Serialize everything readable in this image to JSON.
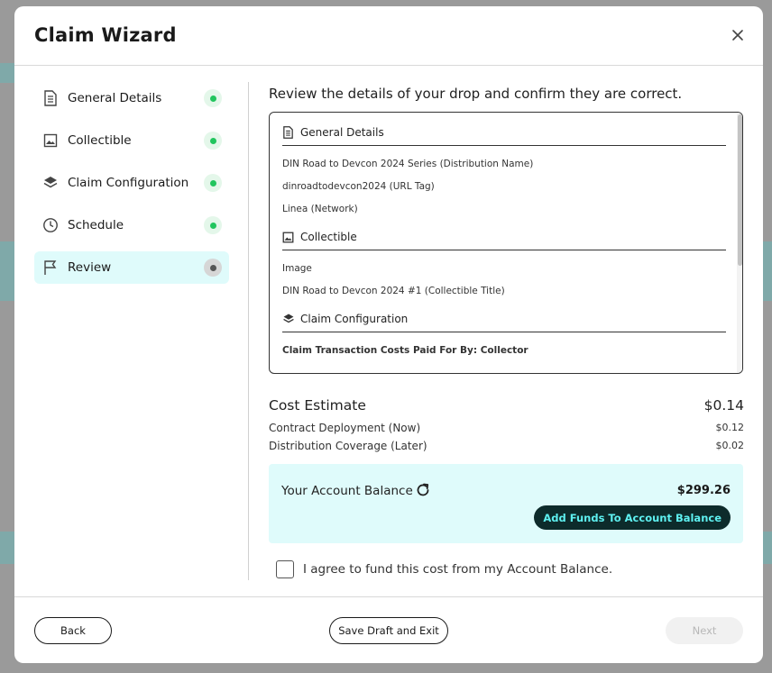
{
  "modal": {
    "title": "Claim Wizard"
  },
  "steps": [
    {
      "label": "General Details",
      "icon": "document-icon",
      "status": "complete"
    },
    {
      "label": "Collectible",
      "icon": "image-icon",
      "status": "complete"
    },
    {
      "label": "Claim Configuration",
      "icon": "layers-icon",
      "status": "complete"
    },
    {
      "label": "Schedule",
      "icon": "clock-icon",
      "status": "complete"
    },
    {
      "label": "Review",
      "icon": "flag-icon",
      "status": "current"
    }
  ],
  "review": {
    "intro": "Review the details of your drop and confirm they are correct.",
    "general": {
      "heading": "General Details",
      "items": [
        "DIN Road to Devcon 2024 Series (Distribution Name)",
        "dinroadtodevcon2024 (URL Tag)",
        "Linea (Network)"
      ]
    },
    "collectible": {
      "heading": "Collectible",
      "items": [
        "Image",
        "DIN Road to Devcon 2024 #1 (Collectible Title)"
      ]
    },
    "claim": {
      "heading": "Claim Configuration",
      "items": [
        "Claim Transaction Costs Paid For By: Collector"
      ]
    }
  },
  "cost": {
    "title": "Cost Estimate",
    "total": "$0.14",
    "rows": [
      {
        "label": "Contract Deployment (Now)",
        "value": "$0.12"
      },
      {
        "label": "Distribution Coverage (Later)",
        "value": "$0.02"
      }
    ]
  },
  "balance": {
    "label": "Your Account Balance",
    "value": "$299.26",
    "add_funds_label": "Add Funds To Account Balance"
  },
  "agree_text": "I agree to fund this cost from my Account Balance.",
  "footer": {
    "back_label": "Back",
    "save_label": "Save Draft and Exit",
    "next_label": "Next"
  },
  "colors": {
    "accent_bg": "#dffbfb",
    "complete_dot": "#22c55e",
    "button_dark": "#0d2b2b",
    "button_text": "#5ef0f0"
  }
}
